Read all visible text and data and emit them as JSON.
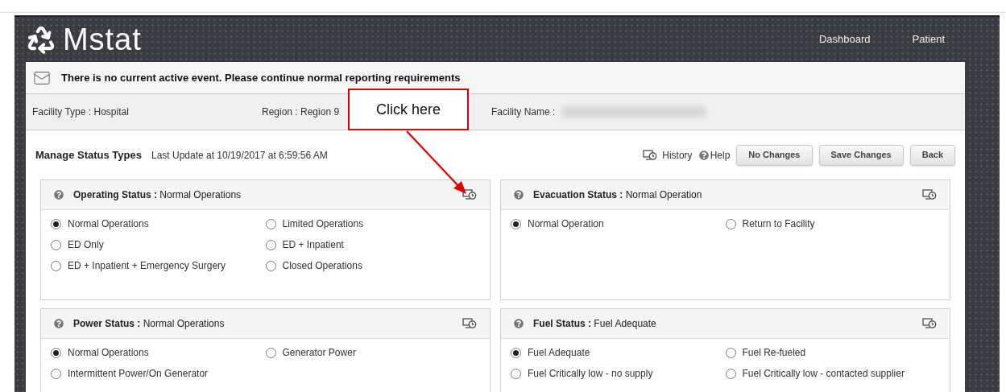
{
  "brand": "Mstat",
  "nav": [
    {
      "label": "Dashboard"
    },
    {
      "label": "Patient"
    }
  ],
  "alert": "There is no current active event. Please continue normal reporting requirements",
  "facility": [
    {
      "text": "Facility Type : Hospital",
      "kind": "plain"
    },
    {
      "text": "Region : Region 9",
      "kind": "plain"
    },
    {
      "text": "Facility Name :",
      "kind": "redacted"
    }
  ],
  "toolbar": {
    "title": "Manage Status Types",
    "last_update": "Last Update at 10/19/2017 at 6:59:56 AM",
    "history": "History",
    "help": "Help",
    "buttons": [
      "No Changes",
      "Save Changes",
      "Back"
    ]
  },
  "panels": [
    {
      "title": "Operating Status :",
      "value": "Normal Operations",
      "options": [
        {
          "label": "Normal Operations",
          "selected": true
        },
        {
          "label": "Limited Operations",
          "selected": false
        },
        {
          "label": "ED Only",
          "selected": false
        },
        {
          "label": "ED + Inpatient",
          "selected": false
        },
        {
          "label": "ED + Inpatient + Emergency Surgery",
          "selected": false
        },
        {
          "label": "Closed Operations",
          "selected": false
        }
      ]
    },
    {
      "title": "Evacuation Status :",
      "value": "Normal Operation",
      "options": [
        {
          "label": "Normal Operation",
          "selected": true
        },
        {
          "label": "Return to Facility",
          "selected": false
        }
      ]
    },
    {
      "title": "Power Status :",
      "value": "Normal Operations",
      "options": [
        {
          "label": "Normal Operations",
          "selected": true
        },
        {
          "label": "Generator Power",
          "selected": false
        },
        {
          "label": "Intermittent Power/On Generator",
          "selected": false
        }
      ]
    },
    {
      "title": "Fuel Status :",
      "value": "Fuel Adequate",
      "options": [
        {
          "label": "Fuel Adequate",
          "selected": true
        },
        {
          "label": "Fuel Re-fueled",
          "selected": false
        },
        {
          "label": "Fuel Critically low - no supply",
          "selected": false
        },
        {
          "label": "Fuel Critically low - contacted supplier",
          "selected": false
        }
      ]
    }
  ],
  "callout": "Click here"
}
